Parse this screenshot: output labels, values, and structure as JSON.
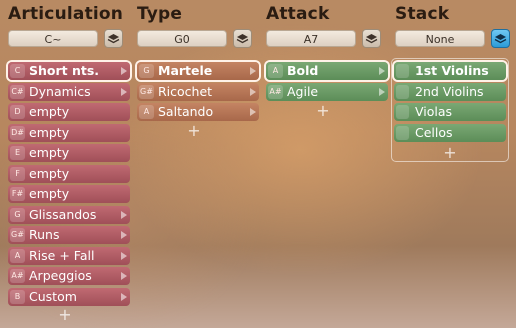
{
  "columns": [
    {
      "title": "Articulation",
      "selector": "C~",
      "rows": [
        {
          "key": "C",
          "label": "Short nts."
        },
        {
          "key": "C#",
          "label": "Dynamics"
        },
        {
          "key": "D",
          "label": "empty"
        },
        {
          "key": "D#",
          "label": "empty"
        },
        {
          "key": "E",
          "label": "empty"
        },
        {
          "key": "F",
          "label": "empty"
        },
        {
          "key": "F#",
          "label": "empty"
        },
        {
          "key": "G",
          "label": "Glissandos"
        },
        {
          "key": "G#",
          "label": "Runs"
        },
        {
          "key": "A",
          "label": "Rise + Fall"
        },
        {
          "key": "A#",
          "label": "Arpeggios"
        },
        {
          "key": "B",
          "label": "Custom"
        }
      ]
    },
    {
      "title": "Type",
      "selector": "G0",
      "rows": [
        {
          "key": "G",
          "label": "Martele"
        },
        {
          "key": "G#",
          "label": "Ricochet"
        },
        {
          "key": "A",
          "label": "Saltando"
        }
      ]
    },
    {
      "title": "Attack",
      "selector": "A7",
      "rows": [
        {
          "key": "A",
          "label": "Bold"
        },
        {
          "key": "A#",
          "label": "Agile"
        }
      ]
    },
    {
      "title": "Stack",
      "selector": "None",
      "rows": [
        {
          "key": "",
          "label": "1st Violins"
        },
        {
          "key": "",
          "label": "2nd Violins"
        },
        {
          "key": "",
          "label": "Violas"
        },
        {
          "key": "",
          "label": "Cellos"
        }
      ]
    }
  ],
  "add_symbol": "+",
  "icons": {
    "stack": "layers-icon"
  },
  "colors": {
    "red": "#a04f58",
    "orange": "#a8684a",
    "green": "#5c8d58",
    "active_icon": "#2b9bd8"
  }
}
